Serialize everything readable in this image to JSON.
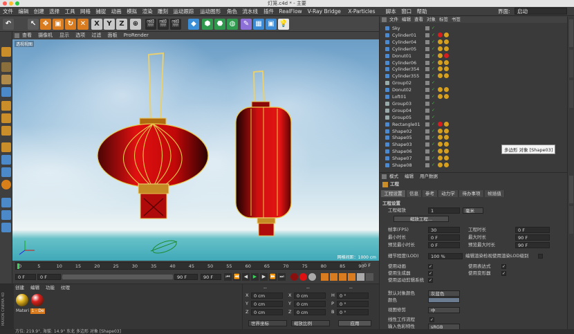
{
  "window": {
    "title": "灯笼.c4d * - 主要"
  },
  "menubar": {
    "items": [
      "文件",
      "编辑",
      "创建",
      "选择",
      "工具",
      "网格",
      "捕捉",
      "动画",
      "模拟",
      "渲染",
      "雕刻",
      "运动跟踪",
      "运动图形",
      "角色",
      "流水线",
      "插件",
      "RealFlow",
      "V-Ray Bridge",
      "X-Particles",
      "脚本",
      "窗口",
      "帮助"
    ],
    "layout_label": "界面:",
    "layout_value": "启动"
  },
  "toolbar": {
    "axis_x": "X",
    "axis_y": "Y",
    "axis_z": "Z"
  },
  "viewport": {
    "menu": [
      "查看",
      "摄像机",
      "显示",
      "选项",
      "过滤",
      "面板",
      "ProRender"
    ],
    "label": "透视视图",
    "grid_spacing": "网格间距：1000 cm"
  },
  "timeline": {
    "ticks": [
      "0",
      "5",
      "10",
      "15",
      "20",
      "25",
      "30",
      "35",
      "40",
      "45",
      "50",
      "55",
      "60",
      "65",
      "70",
      "75",
      "80",
      "85",
      "90"
    ],
    "frame_end_label": "0 F",
    "start": "0 F",
    "start2": "0 F",
    "end": "90 F",
    "end2": "90 F"
  },
  "material_panel": {
    "menu": [
      "创建",
      "编辑",
      "功能",
      "纹理"
    ],
    "materials": [
      {
        "name": "Materi",
        "color": "#e0b21e"
      },
      {
        "name": "1 - De",
        "color": "#d81e1e"
      }
    ],
    "brand": "MAXON CINEMA 4D"
  },
  "coords": {
    "headers": [
      "--",
      "--",
      "--"
    ],
    "rows": [
      {
        "a": "X",
        "av": "0 cm",
        "b": "X",
        "bv": "0 cm",
        "c": "H",
        "cv": "0 °"
      },
      {
        "a": "Y",
        "av": "0 cm",
        "b": "Y",
        "bv": "0 cm",
        "c": "P",
        "cv": "0 °"
      },
      {
        "a": "Z",
        "av": "0 cm",
        "b": "Z",
        "bv": "0 cm",
        "c": "B",
        "cv": "0 °"
      }
    ],
    "mode1": "世界坐标",
    "mode2": "缩放比例",
    "apply": "应用"
  },
  "object_manager": {
    "menu": [
      "文件",
      "编辑",
      "查看",
      "对象",
      "标签",
      "书签"
    ],
    "objects": [
      {
        "name": "Sky",
        "tags": []
      },
      {
        "name": "Cylinder01",
        "tags": [
          "#d61e1e",
          "#d6a01e"
        ]
      },
      {
        "name": "Cylinder04",
        "tags": [
          "#d6a01e",
          "#d6a01e"
        ]
      },
      {
        "name": "Cylinder05",
        "tags": [
          "#d6a01e",
          "#d6a01e"
        ]
      },
      {
        "name": "Donut01",
        "tags": [
          "#d6a01e",
          "#d61e1e"
        ]
      },
      {
        "name": "Cylinder06",
        "tags": [
          "#d6a01e",
          "#d6a01e"
        ]
      },
      {
        "name": "Cylinder354",
        "tags": [
          "#d6a01e",
          "#d6a01e"
        ]
      },
      {
        "name": "Cylinder355",
        "tags": [
          "#d6a01e",
          "#d6a01e"
        ]
      },
      {
        "name": "Group02",
        "tags": []
      },
      {
        "name": "Donut02",
        "tags": [
          "#d6a01e",
          "#d6a01e"
        ]
      },
      {
        "name": "Loft01",
        "tags": [
          "#d6a01e",
          "#d6a01e"
        ]
      },
      {
        "name": "Group03",
        "tags": []
      },
      {
        "name": "Group04",
        "tags": []
      },
      {
        "name": "Group05",
        "tags": []
      },
      {
        "name": "Rectangle01",
        "tags": [
          "#d61e1e",
          "#d6a01e"
        ]
      },
      {
        "name": "Shape02",
        "tags": [
          "#d6a01e",
          "#d6a01e"
        ]
      },
      {
        "name": "Shape05",
        "tags": [
          "#d6a01e",
          "#d6a01e"
        ]
      },
      {
        "name": "Shape03",
        "tags": [
          "#d6a01e",
          "#d6a01e"
        ]
      },
      {
        "name": "Shape06",
        "tags": [
          "#d6a01e",
          "#d6a01e"
        ]
      },
      {
        "name": "Shape07",
        "tags": [
          "#d6a01e",
          "#d6a01e"
        ]
      },
      {
        "name": "Shape08",
        "tags": [
          "#d6a01e",
          "#d6a01e"
        ]
      }
    ],
    "tooltip": "多边形 对象 [Shape03]"
  },
  "attribute_manager": {
    "menu": [
      "模式",
      "编辑",
      "用户数据"
    ],
    "title": "工程",
    "tabs": [
      "工程设置",
      "信息",
      "参考",
      "动力学",
      "待办事项",
      "帧插值"
    ],
    "section": "工程设置",
    "scale_label": "工程缩放",
    "scale_value": "1",
    "scale_unit": "毫米",
    "scale_button": "缩放工程...",
    "fields_left": [
      {
        "label": "帧率(FPS)",
        "value": "30"
      },
      {
        "label": "最小时长",
        "value": "0 F"
      },
      {
        "label": "预览最小时长",
        "value": "0 F"
      }
    ],
    "fields_right": [
      {
        "label": "工程时长",
        "value": "0 F"
      },
      {
        "label": "最大时长",
        "value": "90 F"
      },
      {
        "label": "预览最大时长",
        "value": "90 F"
      }
    ],
    "lod_label": "细节程度(LOD)",
    "lod_value": "100 %",
    "lod_check": "编辑渲染检视使用渲染LOD级别",
    "checks_left": [
      "使用动画",
      "使用生成器",
      "使用运动剪辑系统"
    ],
    "checks_right": [
      "使用表达式",
      "使用变形器"
    ],
    "default_color_label": "默认对象颜色",
    "default_color_value": "灰蓝色",
    "color_label": "颜色",
    "view_clip_label": "视图修剪",
    "view_clip_value": "中",
    "linear_label": "线性工作流程",
    "input_color_label": "输入色彩特性",
    "input_color_value": "sRGB"
  },
  "status": {
    "text": "方位: 219.9°, 海拔: 14.9° 东北   多边形 对象 [Shape03]"
  }
}
